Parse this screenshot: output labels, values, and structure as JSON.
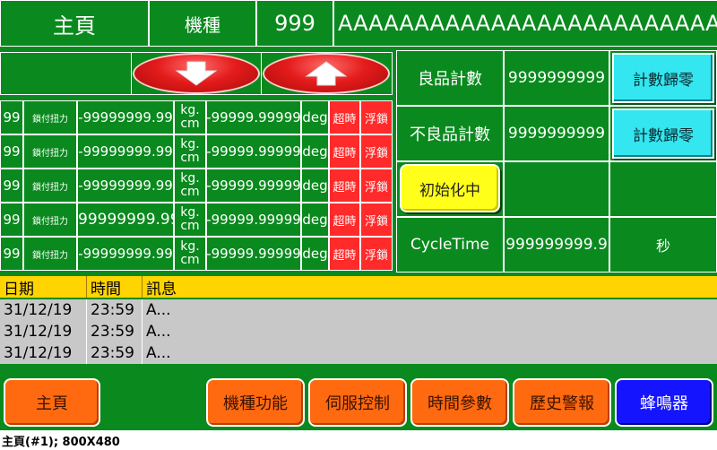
{
  "header": {
    "title": "主頁",
    "model_label": "機種",
    "model_no": "999",
    "model_name": "AAAAAAAAAAAAAAAAAAAAAAAAAAAAAA"
  },
  "arrows": {
    "down": "down-arrow",
    "up": "up-arrow"
  },
  "rows": [
    {
      "id": "99",
      "name": "鎖付扭力",
      "torque": "-99999999.99",
      "unit1": "kg.",
      "unit2": "cm",
      "angle": "-99999.99999",
      "angle_unit": "deg",
      "timeout": "超時",
      "float": "浮鎖"
    },
    {
      "id": "99",
      "name": "鎖付扭力",
      "torque": "-99999999.99",
      "unit1": "kg.",
      "unit2": "cm",
      "angle": "-99999.99999",
      "angle_unit": "deg",
      "timeout": "超時",
      "float": "浮鎖"
    },
    {
      "id": "99",
      "name": "鎖付扭力",
      "torque": "-99999999.99",
      "unit1": "kg.",
      "unit2": "cm",
      "angle": "-99999.99999",
      "angle_unit": "deg",
      "timeout": "超時",
      "float": "浮鎖"
    },
    {
      "id": "99",
      "name": "鎖付扭力",
      "torque": "99999999.99",
      "unit1": "kg.",
      "unit2": "cm",
      "angle": "-99999.99999",
      "angle_unit": "deg",
      "timeout": "超時",
      "float": "浮鎖"
    },
    {
      "id": "99",
      "name": "鎖付扭力",
      "torque": "-99999999.99",
      "unit1": "kg.",
      "unit2": "cm",
      "angle": "-99999.99999",
      "angle_unit": "deg",
      "timeout": "超時",
      "float": "浮鎖"
    }
  ],
  "counters": {
    "good_label": "良品計數",
    "good_value": "9999999999",
    "good_reset": "計數歸零",
    "bad_label": "不良品計數",
    "bad_value": "9999999999",
    "bad_reset": "計數歸零",
    "init_button": "初始化中",
    "cycle_label": "CycleTime",
    "cycle_value": "999999999.9",
    "cycle_unit": "秒"
  },
  "alarm": {
    "headers": {
      "date": "日期",
      "time": "時間",
      "message": "訊息"
    },
    "rows": [
      {
        "date": "31/12/19",
        "time": "23:59",
        "message": "A..."
      },
      {
        "date": "31/12/19",
        "time": "23:59",
        "message": "A..."
      },
      {
        "date": "31/12/19",
        "time": "23:59",
        "message": "A..."
      }
    ]
  },
  "nav": {
    "home": "主頁",
    "model_func": "機種功能",
    "servo": "伺服控制",
    "time_params": "時間參數",
    "history_alarm": "歷史警報",
    "buzzer": "蜂鳴器"
  },
  "caption": "主頁(#1); 800X480",
  "colors": {
    "background": "#0a8a1e",
    "alarm_header": "#ffd400",
    "alarm_row": "#c8c8c8",
    "red_flag": "#ff2a2a",
    "cyan_button": "#33e6ef",
    "yellow_button": "#ffff1a",
    "orange_button": "#ff6a10",
    "blue_button": "#1414ff"
  }
}
